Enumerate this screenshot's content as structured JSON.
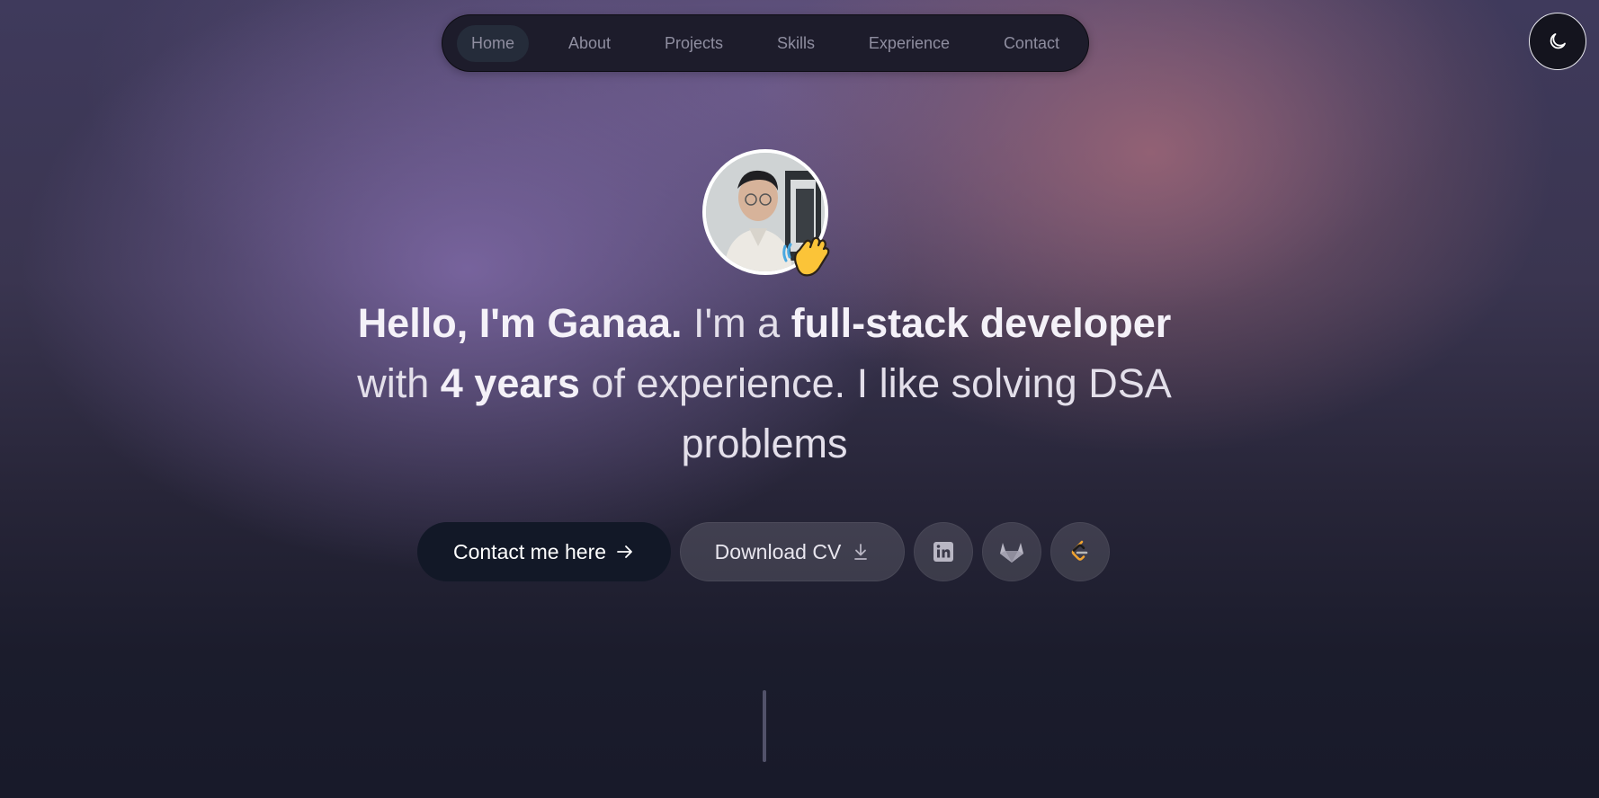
{
  "nav": {
    "items": [
      {
        "label": "Home",
        "active": true
      },
      {
        "label": "About"
      },
      {
        "label": "Projects"
      },
      {
        "label": "Skills"
      },
      {
        "label": "Experience"
      },
      {
        "label": "Contact"
      }
    ]
  },
  "theme_toggle": {
    "icon": "moon-icon"
  },
  "hero": {
    "avatar_badge": "waving-hand-icon",
    "headline": {
      "p1_bold": "Hello, I'm Ganaa.",
      "p2": " I'm a ",
      "p3_bold": "full-stack developer",
      "p4": " with ",
      "p5_bold": "4 years",
      "p6": " of experience. I like solving DSA problems"
    }
  },
  "actions": {
    "contact_label": "Contact me here",
    "contact_icon": "arrow-right-icon",
    "download_label": "Download CV",
    "download_icon": "download-icon",
    "socials": [
      {
        "icon": "linkedin-icon"
      },
      {
        "icon": "gitlab-icon"
      },
      {
        "icon": "leetcode-icon"
      }
    ]
  },
  "colors": {
    "nav_bg": "#1d1c2b",
    "primary_button": "#121827",
    "text": "#e3dfea"
  }
}
